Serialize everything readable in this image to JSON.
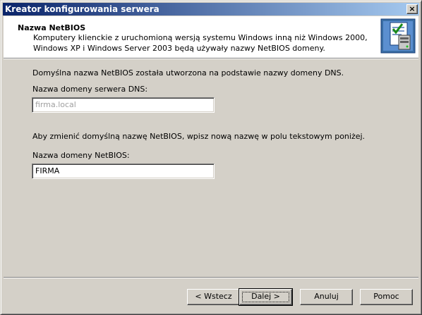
{
  "window": {
    "title": "Kreator konfigurowania serwera",
    "close_label": "×"
  },
  "header": {
    "title": "Nazwa NetBIOS",
    "description": "Komputery klienckie z uruchomioną wersją systemu Windows inną niż Windows 2000, Windows XP i Windows Server 2003 będą używały nazwy NetBIOS domeny.",
    "icon": "server-wizard-icon"
  },
  "body": {
    "intro": "Domyślna nazwa NetBIOS została utworzona na podstawie nazwy domeny DNS.",
    "dns_label": "Nazwa domeny serwera DNS:",
    "dns_value": "firma.local",
    "change_hint": "Aby zmienić domyślną nazwę NetBIOS, wpisz nową nazwę w polu tekstowym poniżej.",
    "netbios_label": "Nazwa domeny NetBIOS:",
    "netbios_value": "FIRMA"
  },
  "buttons": {
    "back": "< Wstecz",
    "next": "Dalej >",
    "cancel": "Anuluj",
    "help": "Pomoc"
  }
}
